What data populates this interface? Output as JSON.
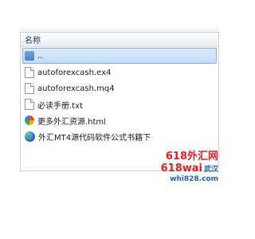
{
  "header": {
    "column_name": "名称"
  },
  "files": [
    {
      "name": "..",
      "icon": "up-folder-icon",
      "selected": true
    },
    {
      "name": "autoforexcash.ex4",
      "icon": "document-icon"
    },
    {
      "name": "autoforexcash.mq4",
      "icon": "document-icon"
    },
    {
      "name": "必读手册.txt",
      "icon": "text-file-icon"
    },
    {
      "name": "更多外汇资源.html",
      "icon": "html-file-icon"
    },
    {
      "name": "外汇MT4源代码软件公式书籍下",
      "icon": "web-link-icon"
    }
  ],
  "watermark": {
    "line1": "618外汇网",
    "line2": "618wai",
    "line2_cn": "武汉",
    "line3": "whi828.com"
  }
}
